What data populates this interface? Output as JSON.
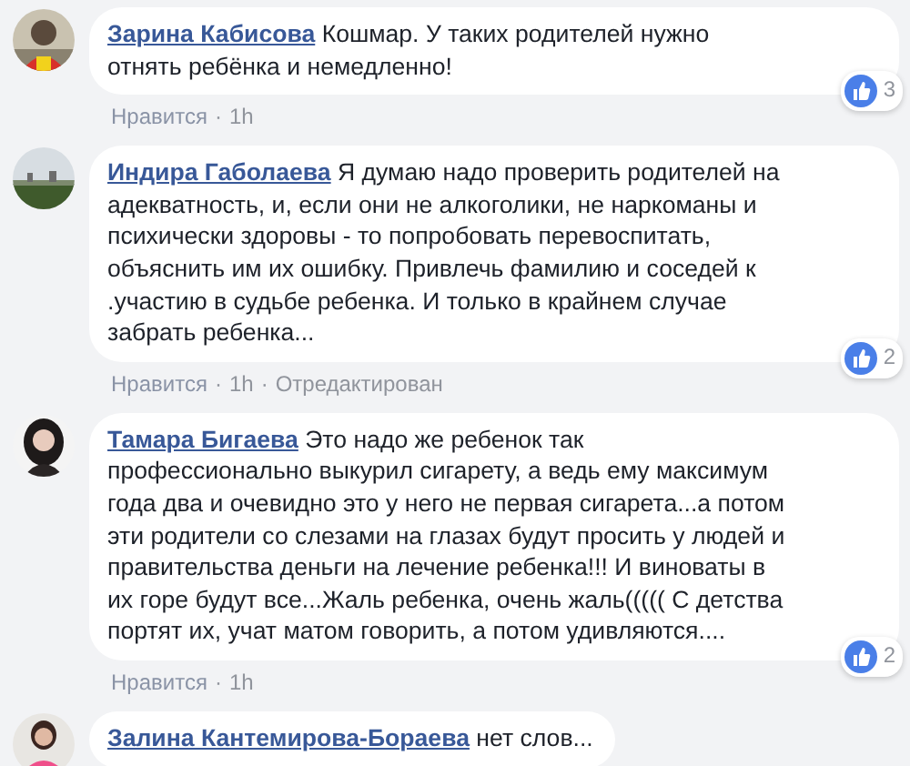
{
  "comments": [
    {
      "author": "Зарина Кабисова",
      "text": "Кошмар. У таких родителей нужно отнять ребёнка и немедленно!",
      "reactions": "3",
      "meta": [
        {
          "kind": "link",
          "text": "Нравится"
        },
        {
          "kind": "dot",
          "text": "·"
        },
        {
          "kind": "time",
          "text": "1h"
        }
      ]
    },
    {
      "author": "Индира Габолаева",
      "text": "Я думаю надо проверить родителей на адекватность, и, если они не алкоголики, не наркоманы и психически здоровы - то попробовать перевоспитать, объяснить им их ошибку. Привлечь фамилию и соседей к .участию в судьбе ребенка. И только в крайнем случае забрать ребенка...",
      "reactions": "2",
      "meta": [
        {
          "kind": "link",
          "text": "Нравится"
        },
        {
          "kind": "dot",
          "text": "·"
        },
        {
          "kind": "time",
          "text": "1h"
        },
        {
          "kind": "dot",
          "text": "·"
        },
        {
          "kind": "note",
          "text": "Отредактирован"
        }
      ]
    },
    {
      "author": "Тамара Бигаева",
      "text": "Это надо же ребенок так профессионально выкурил сигарету, а ведь ему максимум года два и очевидно это у него не первая сигарета...а потом эти родители со слезами на глазах будут просить у людей и правительства деньги на лечение ребенка!!! И виноваты в их горе будут все...Жаль ребенка, очень жаль((((( С детства портят их, учат матом говорить, а потом удивляются....",
      "reactions": "2",
      "meta": [
        {
          "kind": "link",
          "text": "Нравится"
        },
        {
          "kind": "dot",
          "text": "·"
        },
        {
          "kind": "time",
          "text": "1h"
        }
      ]
    },
    {
      "author": "Залина Кантемирова-Бораева",
      "text": "нет слов..."
    }
  ]
}
